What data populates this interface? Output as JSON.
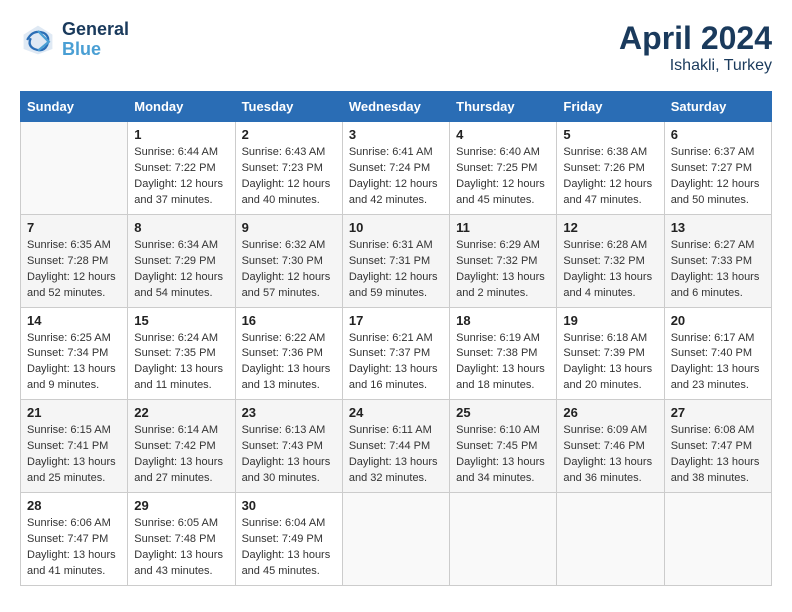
{
  "header": {
    "logo_line1": "General",
    "logo_line2": "Blue",
    "month": "April 2024",
    "location": "Ishakli, Turkey"
  },
  "weekdays": [
    "Sunday",
    "Monday",
    "Tuesday",
    "Wednesday",
    "Thursday",
    "Friday",
    "Saturday"
  ],
  "weeks": [
    [
      {
        "day": "",
        "info": ""
      },
      {
        "day": "1",
        "info": "Sunrise: 6:44 AM\nSunset: 7:22 PM\nDaylight: 12 hours\nand 37 minutes."
      },
      {
        "day": "2",
        "info": "Sunrise: 6:43 AM\nSunset: 7:23 PM\nDaylight: 12 hours\nand 40 minutes."
      },
      {
        "day": "3",
        "info": "Sunrise: 6:41 AM\nSunset: 7:24 PM\nDaylight: 12 hours\nand 42 minutes."
      },
      {
        "day": "4",
        "info": "Sunrise: 6:40 AM\nSunset: 7:25 PM\nDaylight: 12 hours\nand 45 minutes."
      },
      {
        "day": "5",
        "info": "Sunrise: 6:38 AM\nSunset: 7:26 PM\nDaylight: 12 hours\nand 47 minutes."
      },
      {
        "day": "6",
        "info": "Sunrise: 6:37 AM\nSunset: 7:27 PM\nDaylight: 12 hours\nand 50 minutes."
      }
    ],
    [
      {
        "day": "7",
        "info": "Sunrise: 6:35 AM\nSunset: 7:28 PM\nDaylight: 12 hours\nand 52 minutes."
      },
      {
        "day": "8",
        "info": "Sunrise: 6:34 AM\nSunset: 7:29 PM\nDaylight: 12 hours\nand 54 minutes."
      },
      {
        "day": "9",
        "info": "Sunrise: 6:32 AM\nSunset: 7:30 PM\nDaylight: 12 hours\nand 57 minutes."
      },
      {
        "day": "10",
        "info": "Sunrise: 6:31 AM\nSunset: 7:31 PM\nDaylight: 12 hours\nand 59 minutes."
      },
      {
        "day": "11",
        "info": "Sunrise: 6:29 AM\nSunset: 7:32 PM\nDaylight: 13 hours\nand 2 minutes."
      },
      {
        "day": "12",
        "info": "Sunrise: 6:28 AM\nSunset: 7:32 PM\nDaylight: 13 hours\nand 4 minutes."
      },
      {
        "day": "13",
        "info": "Sunrise: 6:27 AM\nSunset: 7:33 PM\nDaylight: 13 hours\nand 6 minutes."
      }
    ],
    [
      {
        "day": "14",
        "info": "Sunrise: 6:25 AM\nSunset: 7:34 PM\nDaylight: 13 hours\nand 9 minutes."
      },
      {
        "day": "15",
        "info": "Sunrise: 6:24 AM\nSunset: 7:35 PM\nDaylight: 13 hours\nand 11 minutes."
      },
      {
        "day": "16",
        "info": "Sunrise: 6:22 AM\nSunset: 7:36 PM\nDaylight: 13 hours\nand 13 minutes."
      },
      {
        "day": "17",
        "info": "Sunrise: 6:21 AM\nSunset: 7:37 PM\nDaylight: 13 hours\nand 16 minutes."
      },
      {
        "day": "18",
        "info": "Sunrise: 6:19 AM\nSunset: 7:38 PM\nDaylight: 13 hours\nand 18 minutes."
      },
      {
        "day": "19",
        "info": "Sunrise: 6:18 AM\nSunset: 7:39 PM\nDaylight: 13 hours\nand 20 minutes."
      },
      {
        "day": "20",
        "info": "Sunrise: 6:17 AM\nSunset: 7:40 PM\nDaylight: 13 hours\nand 23 minutes."
      }
    ],
    [
      {
        "day": "21",
        "info": "Sunrise: 6:15 AM\nSunset: 7:41 PM\nDaylight: 13 hours\nand 25 minutes."
      },
      {
        "day": "22",
        "info": "Sunrise: 6:14 AM\nSunset: 7:42 PM\nDaylight: 13 hours\nand 27 minutes."
      },
      {
        "day": "23",
        "info": "Sunrise: 6:13 AM\nSunset: 7:43 PM\nDaylight: 13 hours\nand 30 minutes."
      },
      {
        "day": "24",
        "info": "Sunrise: 6:11 AM\nSunset: 7:44 PM\nDaylight: 13 hours\nand 32 minutes."
      },
      {
        "day": "25",
        "info": "Sunrise: 6:10 AM\nSunset: 7:45 PM\nDaylight: 13 hours\nand 34 minutes."
      },
      {
        "day": "26",
        "info": "Sunrise: 6:09 AM\nSunset: 7:46 PM\nDaylight: 13 hours\nand 36 minutes."
      },
      {
        "day": "27",
        "info": "Sunrise: 6:08 AM\nSunset: 7:47 PM\nDaylight: 13 hours\nand 38 minutes."
      }
    ],
    [
      {
        "day": "28",
        "info": "Sunrise: 6:06 AM\nSunset: 7:47 PM\nDaylight: 13 hours\nand 41 minutes."
      },
      {
        "day": "29",
        "info": "Sunrise: 6:05 AM\nSunset: 7:48 PM\nDaylight: 13 hours\nand 43 minutes."
      },
      {
        "day": "30",
        "info": "Sunrise: 6:04 AM\nSunset: 7:49 PM\nDaylight: 13 hours\nand 45 minutes."
      },
      {
        "day": "",
        "info": ""
      },
      {
        "day": "",
        "info": ""
      },
      {
        "day": "",
        "info": ""
      },
      {
        "day": "",
        "info": ""
      }
    ]
  ]
}
